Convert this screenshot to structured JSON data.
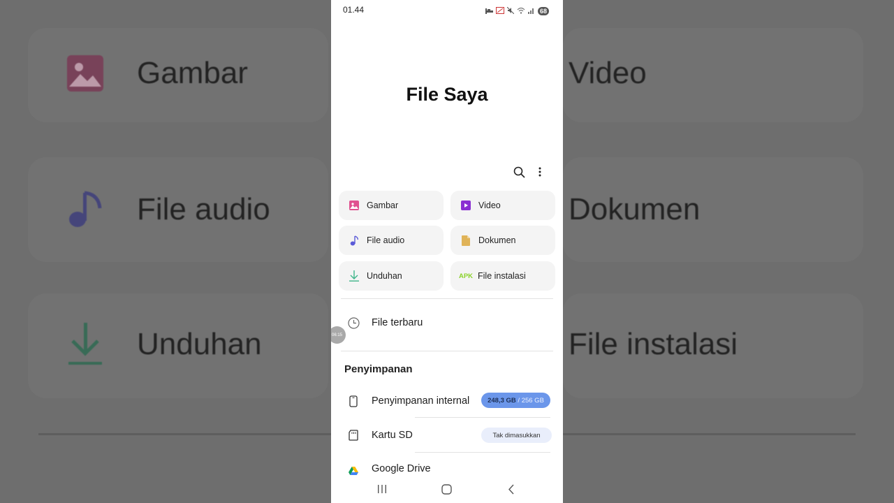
{
  "status": {
    "time": "01.44",
    "battery": "68"
  },
  "title": "File Saya",
  "actions": {
    "search": "search-icon",
    "more": "more-vert-icon"
  },
  "categories": [
    {
      "label": "Gambar",
      "icon": "image-icon",
      "color": "#e05290"
    },
    {
      "label": "Video",
      "icon": "video-icon",
      "color": "#8a2fd2"
    },
    {
      "label": "File audio",
      "icon": "music-note-icon",
      "color": "#5b5bd8"
    },
    {
      "label": "Dokumen",
      "icon": "document-icon",
      "color": "#e0b358"
    },
    {
      "label": "Unduhan",
      "icon": "download-icon",
      "color": "#3fb58a"
    },
    {
      "label": "File instalasi",
      "icon": "apk-icon",
      "icon_text": "APK",
      "color": "#8bd22b"
    }
  ],
  "recent": {
    "label": "File terbaru",
    "icon": "clock-icon"
  },
  "storage": {
    "heading": "Penyimpanan",
    "internal": {
      "label": "Penyimpanan internal",
      "used": "248,3 GB",
      "separator": " / ",
      "total": "256 GB"
    },
    "sd": {
      "label": "Kartu SD",
      "status": "Tak dimasukkan"
    },
    "drive": {
      "label": "Google Drive"
    }
  },
  "floating": {
    "text": "06:15"
  },
  "background": {
    "labels": [
      "Gambar",
      "Video",
      "File audio",
      "Dokumen",
      "Unduhan",
      "File instalasi"
    ]
  },
  "colors": {
    "accent": "#6b96ea",
    "pill_light": "#e9eefb"
  }
}
